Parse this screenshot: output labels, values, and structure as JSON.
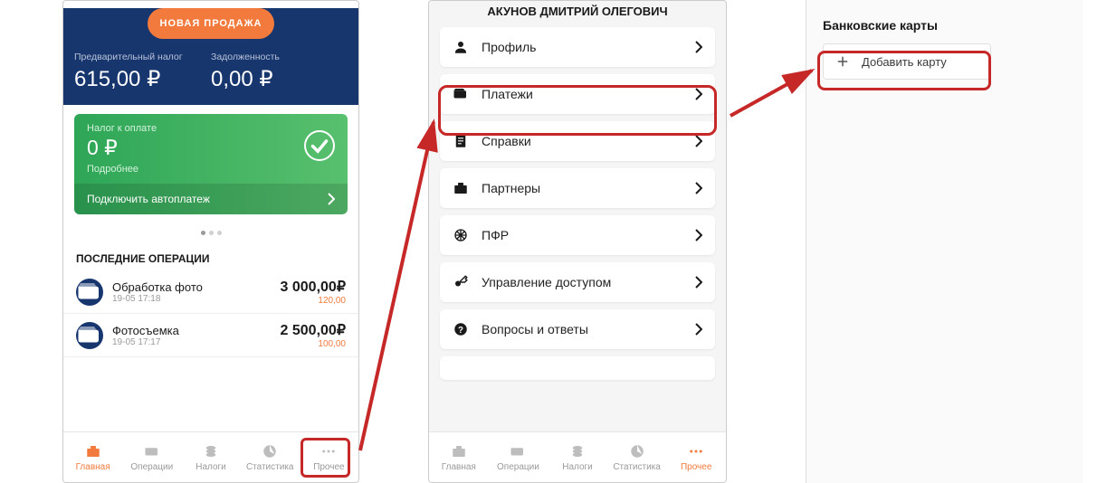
{
  "screen1": {
    "new_sale_btn": "НОВАЯ ПРОДАЖА",
    "pretax_label": "Предварительный налог",
    "pretax_value": "615,00 ₽",
    "debt_label": "Задолженность",
    "debt_value": "0,00 ₽",
    "green": {
      "label": "Налог к оплате",
      "value": "0 ₽",
      "more": "Подробнее",
      "autopay": "Подключить автоплатеж"
    },
    "ops_heading": "ПОСЛЕДНИЕ ОПЕРАЦИИ",
    "ops": [
      {
        "title": "Обработка фото",
        "time": "19-05 17:18",
        "amount": "3 000,00₽",
        "sub": "120,00"
      },
      {
        "title": "Фотосъемка",
        "time": "19-05 17:17",
        "amount": "2 500,00₽",
        "sub": "100,00"
      }
    ],
    "nav": {
      "home": "Главная",
      "operations": "Операции",
      "taxes": "Налоги",
      "stats": "Статистика",
      "more": "Прочее"
    }
  },
  "screen2": {
    "user_name": "АКУНОВ ДМИТРИЙ ОЛЕГОВИЧ",
    "menu": {
      "profile": "Профиль",
      "payments": "Платежи",
      "inquiries": "Справки",
      "partners": "Партнеры",
      "pfr": "ПФР",
      "access": "Управление доступом",
      "faq": "Вопросы и ответы"
    },
    "nav": {
      "home": "Главная",
      "operations": "Операции",
      "taxes": "Налоги",
      "stats": "Статистика",
      "more": "Прочее"
    }
  },
  "screen3": {
    "title": "Банковские карты",
    "add_card": "Добавить карту"
  }
}
